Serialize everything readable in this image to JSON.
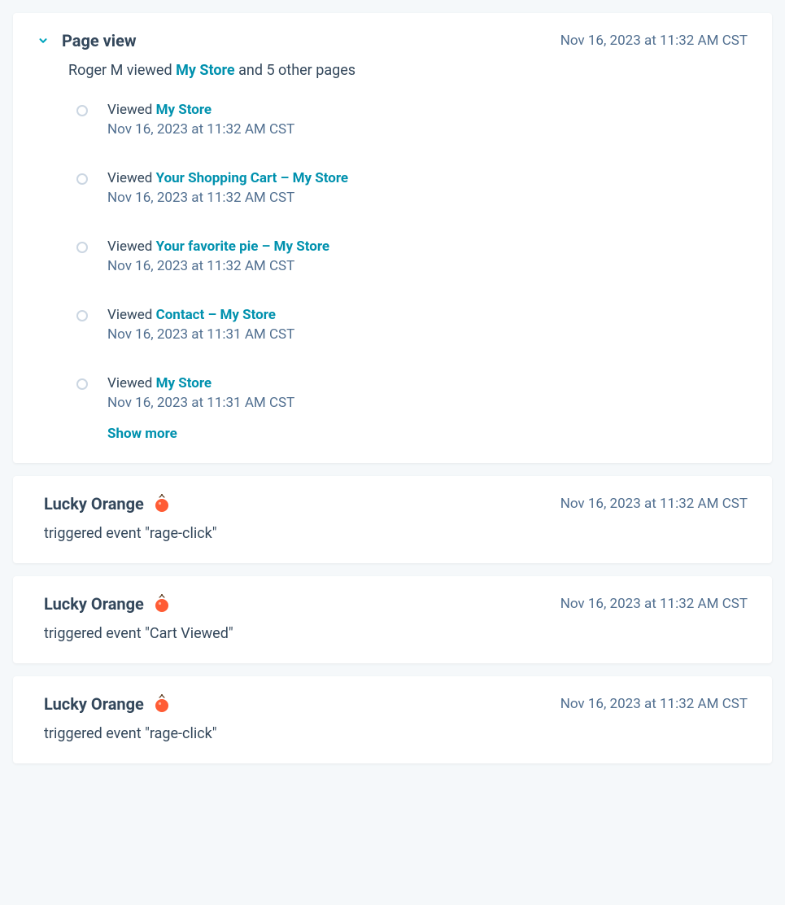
{
  "page_view": {
    "title": "Page view",
    "timestamp": "Nov 16, 2023 at 11:32 AM CST",
    "summary_prefix": "Roger M viewed ",
    "summary_link": "My Store",
    "summary_suffix": " and 5 other pages",
    "show_more_label": "Show more",
    "items": [
      {
        "prefix": "Viewed ",
        "page": "My Store",
        "timestamp": "Nov 16, 2023 at 11:32 AM CST"
      },
      {
        "prefix": "Viewed ",
        "page": "Your Shopping Cart – My Store",
        "timestamp": "Nov 16, 2023 at 11:32 AM CST"
      },
      {
        "prefix": "Viewed ",
        "page": "Your favorite pie – My Store",
        "timestamp": "Nov 16, 2023 at 11:32 AM CST"
      },
      {
        "prefix": "Viewed ",
        "page": "Contact – My Store",
        "timestamp": "Nov 16, 2023 at 11:31 AM CST"
      },
      {
        "prefix": "Viewed ",
        "page": "My Store",
        "timestamp": "Nov 16, 2023 at 11:31 AM CST"
      }
    ]
  },
  "events": [
    {
      "title": "Lucky Orange",
      "timestamp": "Nov 16, 2023 at 11:32 AM CST",
      "description": "triggered event \"rage-click\""
    },
    {
      "title": "Lucky Orange",
      "timestamp": "Nov 16, 2023 at 11:32 AM CST",
      "description": "triggered event \"Cart Viewed\""
    },
    {
      "title": "Lucky Orange",
      "timestamp": "Nov 16, 2023 at 11:32 AM CST",
      "description": "triggered event \"rage-click\""
    }
  ]
}
